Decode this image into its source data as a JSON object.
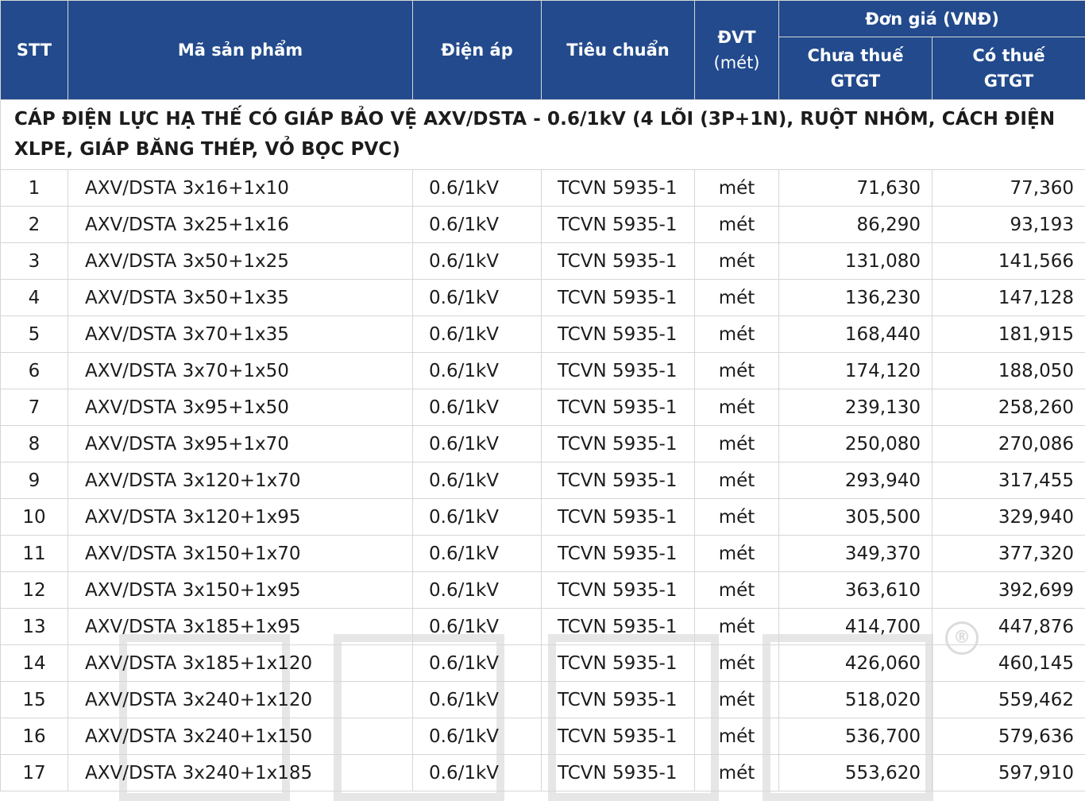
{
  "header": {
    "stt": "STT",
    "product_code": "Mã sản phẩm",
    "voltage": "Điện áp",
    "standard": "Tiêu chuẩn",
    "unit_line1": "ĐVT",
    "unit_line2": "(mét)",
    "price_group": "Đơn giá (VNĐ)",
    "price_excl_line1": "Chưa thuế",
    "price_excl_line2": "GTGT",
    "price_incl_line1": "Có thuế",
    "price_incl_line2": "GTGT"
  },
  "section_title": "CÁP ĐIỆN LỰC HẠ THẾ CÓ GIÁP BẢO VỆ AXV/DSTA - 0.6/1kV (4 LÕI (3P+1N), RUỘT NHÔM, CÁCH ĐIỆN XLPE, GIÁP BĂNG THÉP, VỎ BỌC PVC)",
  "rows": [
    {
      "stt": "1",
      "code": "AXV/DSTA 3x16+1x10",
      "voltage": "0.6/1kV",
      "standard": "TCVN 5935-1",
      "unit": "mét",
      "price_excl": "71,630",
      "price_incl": "77,360"
    },
    {
      "stt": "2",
      "code": "AXV/DSTA 3x25+1x16",
      "voltage": "0.6/1kV",
      "standard": "TCVN 5935-1",
      "unit": "mét",
      "price_excl": "86,290",
      "price_incl": "93,193"
    },
    {
      "stt": "3",
      "code": "AXV/DSTA 3x50+1x25",
      "voltage": "0.6/1kV",
      "standard": "TCVN 5935-1",
      "unit": "mét",
      "price_excl": "131,080",
      "price_incl": "141,566"
    },
    {
      "stt": "4",
      "code": "AXV/DSTA 3x50+1x35",
      "voltage": "0.6/1kV",
      "standard": "TCVN 5935-1",
      "unit": "mét",
      "price_excl": "136,230",
      "price_incl": "147,128"
    },
    {
      "stt": "5",
      "code": "AXV/DSTA 3x70+1x35",
      "voltage": "0.6/1kV",
      "standard": "TCVN 5935-1",
      "unit": "mét",
      "price_excl": "168,440",
      "price_incl": "181,915"
    },
    {
      "stt": "6",
      "code": "AXV/DSTA 3x70+1x50",
      "voltage": "0.6/1kV",
      "standard": "TCVN 5935-1",
      "unit": "mét",
      "price_excl": "174,120",
      "price_incl": "188,050"
    },
    {
      "stt": "7",
      "code": "AXV/DSTA 3x95+1x50",
      "voltage": "0.6/1kV",
      "standard": "TCVN 5935-1",
      "unit": "mét",
      "price_excl": "239,130",
      "price_incl": "258,260"
    },
    {
      "stt": "8",
      "code": "AXV/DSTA 3x95+1x70",
      "voltage": "0.6/1kV",
      "standard": "TCVN 5935-1",
      "unit": "mét",
      "price_excl": "250,080",
      "price_incl": "270,086"
    },
    {
      "stt": "9",
      "code": "AXV/DSTA 3x120+1x70",
      "voltage": "0.6/1kV",
      "standard": "TCVN 5935-1",
      "unit": "mét",
      "price_excl": "293,940",
      "price_incl": "317,455"
    },
    {
      "stt": "10",
      "code": "AXV/DSTA 3x120+1x95",
      "voltage": "0.6/1kV",
      "standard": "TCVN 5935-1",
      "unit": "mét",
      "price_excl": "305,500",
      "price_incl": "329,940"
    },
    {
      "stt": "11",
      "code": "AXV/DSTA 3x150+1x70",
      "voltage": "0.6/1kV",
      "standard": "TCVN 5935-1",
      "unit": "mét",
      "price_excl": "349,370",
      "price_incl": "377,320"
    },
    {
      "stt": "12",
      "code": "AXV/DSTA 3x150+1x95",
      "voltage": "0.6/1kV",
      "standard": "TCVN 5935-1",
      "unit": "mét",
      "price_excl": "363,610",
      "price_incl": "392,699"
    },
    {
      "stt": "13",
      "code": "AXV/DSTA 3x185+1x95",
      "voltage": "0.6/1kV",
      "standard": "TCVN 5935-1",
      "unit": "mét",
      "price_excl": "414,700",
      "price_incl": "447,876"
    },
    {
      "stt": "14",
      "code": "AXV/DSTA 3x185+1x120",
      "voltage": "0.6/1kV",
      "standard": "TCVN 5935-1",
      "unit": "mét",
      "price_excl": "426,060",
      "price_incl": "460,145"
    },
    {
      "stt": "15",
      "code": "AXV/DSTA 3x240+1x120",
      "voltage": "0.6/1kV",
      "standard": "TCVN 5935-1",
      "unit": "mét",
      "price_excl": "518,020",
      "price_incl": "559,462"
    },
    {
      "stt": "16",
      "code": "AXV/DSTA 3x240+1x150",
      "voltage": "0.6/1kV",
      "standard": "TCVN 5935-1",
      "unit": "mét",
      "price_excl": "536,700",
      "price_incl": "579,636"
    },
    {
      "stt": "17",
      "code": "AXV/DSTA 3x240+1x185",
      "voltage": "0.6/1kV",
      "standard": "TCVN 5935-1",
      "unit": "mét",
      "price_excl": "553,620",
      "price_incl": "597,910"
    }
  ],
  "colors": {
    "header_bg": "#224a8c",
    "header_text": "#ffffff",
    "grid": "#d6d6d6"
  },
  "watermark": {
    "icon": "brand-logo-watermark",
    "registered_symbol": "®"
  }
}
